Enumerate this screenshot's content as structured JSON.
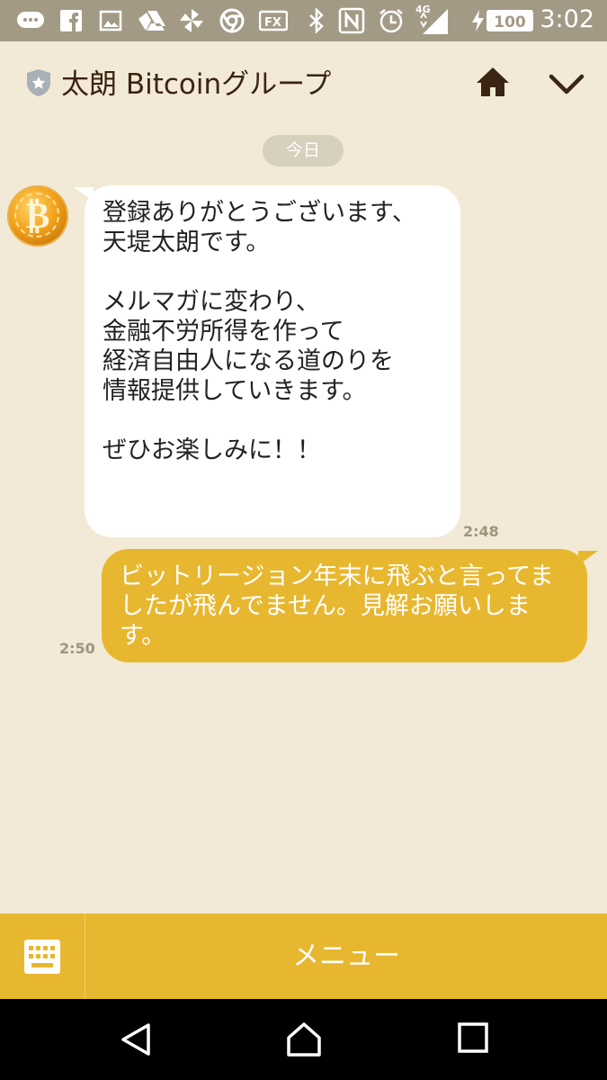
{
  "status_bar": {
    "time": "3:02",
    "battery": "100",
    "network": "4G",
    "icons": [
      "message-icon",
      "facebook-icon",
      "image-icon",
      "drive-icon",
      "pinwheel-icon",
      "chrome-icon",
      "fx-icon",
      "bluetooth-icon",
      "nfc-icon",
      "alarm-icon",
      "signal-icon",
      "charging-icon"
    ]
  },
  "header": {
    "title": "太朗 Bitcoinグループ",
    "home_icon": "home-icon",
    "more_icon": "chevron-down-icon"
  },
  "chat": {
    "date_label": "今日",
    "messages": [
      {
        "direction": "incoming",
        "text": "登録ありがとうございます、\n天堤太朗です。\n\nメルマガに変わり、\n金融不労所得を作って\n経済自由人になる道のりを\n情報提供していきます。\n\nぜひお楽しみに！！",
        "time": "2:48"
      },
      {
        "direction": "outgoing",
        "text": "ビットリージョン年末に飛ぶと言ってましたが飛んでません。見解お願いします。",
        "time": "2:50"
      }
    ]
  },
  "bottom_bar": {
    "keyboard_icon": "keyboard-icon",
    "menu_label": "メニュー"
  },
  "colors": {
    "background": "#f2ead6",
    "accent": "#e8b730",
    "status_bar": "#a39a86"
  }
}
